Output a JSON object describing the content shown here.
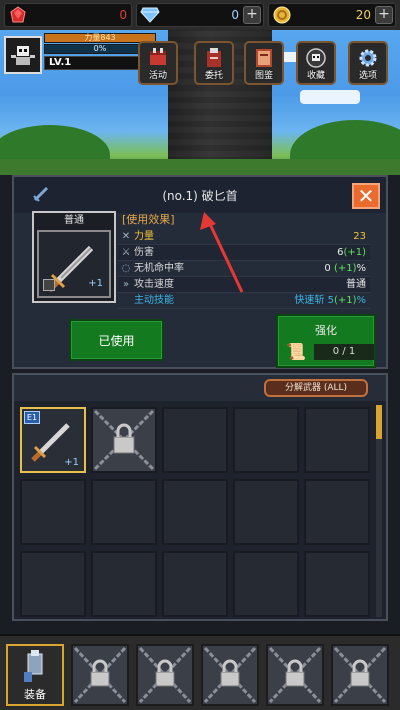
{
  "resources": {
    "ruby": "0",
    "diamond": "0",
    "gold": "20"
  },
  "player": {
    "stat_label": "力量",
    "stat_value": "843",
    "xp_label": "0%",
    "level": "LV.1"
  },
  "menu": [
    {
      "label": "活动",
      "icon": "event-icon"
    },
    {
      "label": "委托",
      "icon": "quest-icon"
    },
    {
      "label": "图鉴",
      "icon": "book-icon"
    },
    {
      "label": "收藏",
      "icon": "skull-icon"
    },
    {
      "label": "选项",
      "icon": "gear-icon"
    }
  ],
  "item": {
    "title": "(no.1) 破匕首",
    "rarity": "普通",
    "enhance": "+1",
    "effect_header": "[使用效果]",
    "stats": [
      {
        "name": "力量",
        "value": "23",
        "icon": "strength-icon"
      },
      {
        "name": "伤害",
        "value": "6",
        "bonus": "(+1)",
        "icon": "damage-icon"
      },
      {
        "name": "无机命中率",
        "value": "0",
        "bonus": "(+1)",
        "suffix": "%",
        "icon": "hit-icon"
      },
      {
        "name": "攻击速度",
        "value": "普通",
        "icon": "speed-icon"
      },
      {
        "name": "主动技能",
        "value": "快速斩 5",
        "bonus": "(+1)",
        "suffix": "%",
        "icon": ""
      }
    ],
    "used_label": "已使用",
    "upgrade_label": "强化",
    "upgrade_count": "0 / 1"
  },
  "inventory": {
    "disassemble_label": "分解武器 (ALL)",
    "first_badge": "E1",
    "first_plus": "+1"
  },
  "bottom": {
    "equip_label": "装备"
  },
  "colors": {
    "accent_orange": "#e96b2d",
    "gold": "#f0c23a",
    "skill_blue": "#3cb6e6",
    "bonus_green": "#5be45b",
    "button_green": "#137a1f"
  }
}
